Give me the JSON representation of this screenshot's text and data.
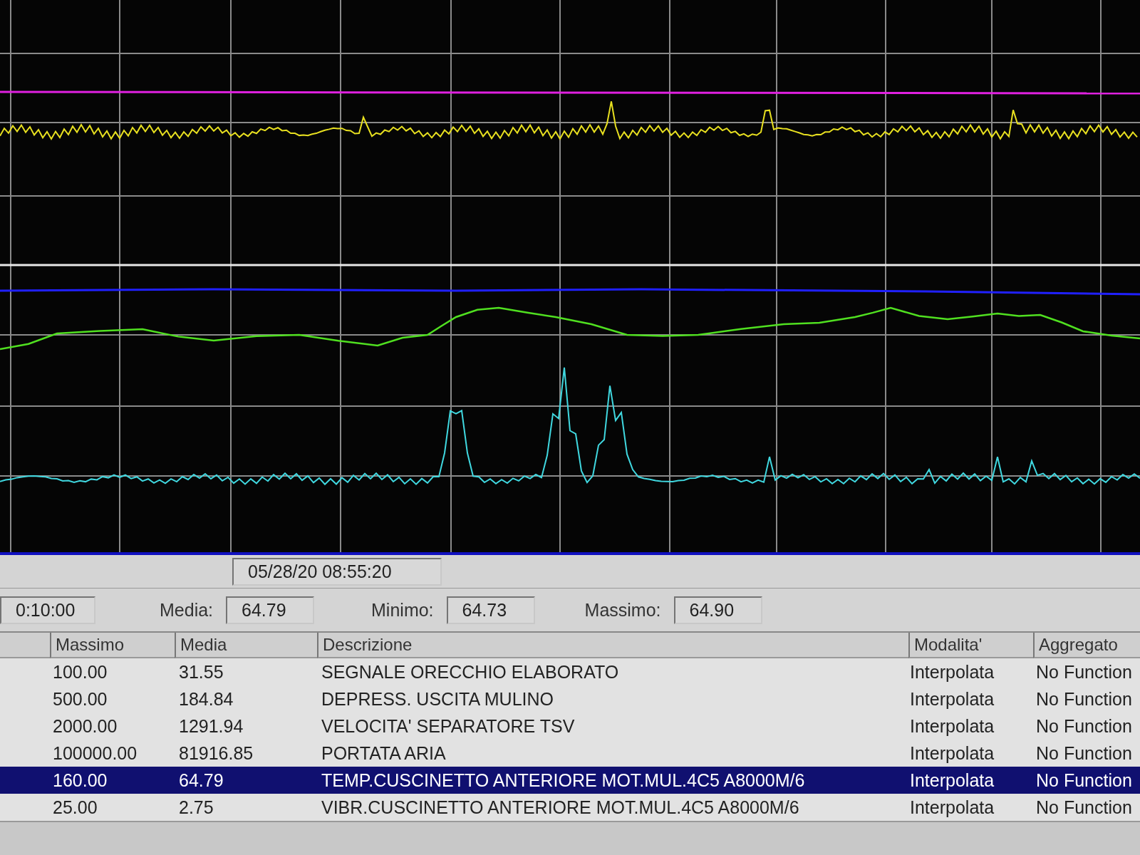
{
  "timestamp": "05/28/20 08:55:20",
  "stats": {
    "span": "0:10:00",
    "media_label": "Media:",
    "media": "64.79",
    "minimo_label": "Minimo:",
    "minimo": "64.73",
    "massimo_label": "Massimo:",
    "massimo": "64.90"
  },
  "table": {
    "columns": [
      "Massimo",
      "Media",
      "Descrizione",
      "Modalita'",
      "Aggregato"
    ],
    "rows": [
      {
        "massimo": "100.00",
        "media": "31.55",
        "descrizione": "SEGNALE ORECCHIO ELABORATO",
        "modalita": "Interpolata",
        "aggregato": "No Function",
        "selected": false
      },
      {
        "massimo": "500.00",
        "media": "184.84",
        "descrizione": "DEPRESS. USCITA MULINO",
        "modalita": "Interpolata",
        "aggregato": "No Function",
        "selected": false
      },
      {
        "massimo": "2000.00",
        "media": "1291.94",
        "descrizione": "VELOCITA' SEPARATORE TSV",
        "modalita": "Interpolata",
        "aggregato": "No Function",
        "selected": false
      },
      {
        "massimo": "100000.00",
        "media": "81916.85",
        "descrizione": "PORTATA ARIA",
        "modalita": "Interpolata",
        "aggregato": "No Function",
        "selected": false
      },
      {
        "massimo": "160.00",
        "media": "64.79",
        "descrizione": "TEMP.CUSCINETTO ANTERIORE MOT.MUL.4C5 A8000M/6",
        "modalita": "Interpolata",
        "aggregato": "No Function",
        "selected": true
      },
      {
        "massimo": "25.00",
        "media": "2.75",
        "descrizione": "VIBR.CUSCINETTO ANTERIORE MOT.MUL.4C5 A8000M/6",
        "modalita": "Interpolata",
        "aggregato": "No Function",
        "selected": false
      }
    ]
  }
}
